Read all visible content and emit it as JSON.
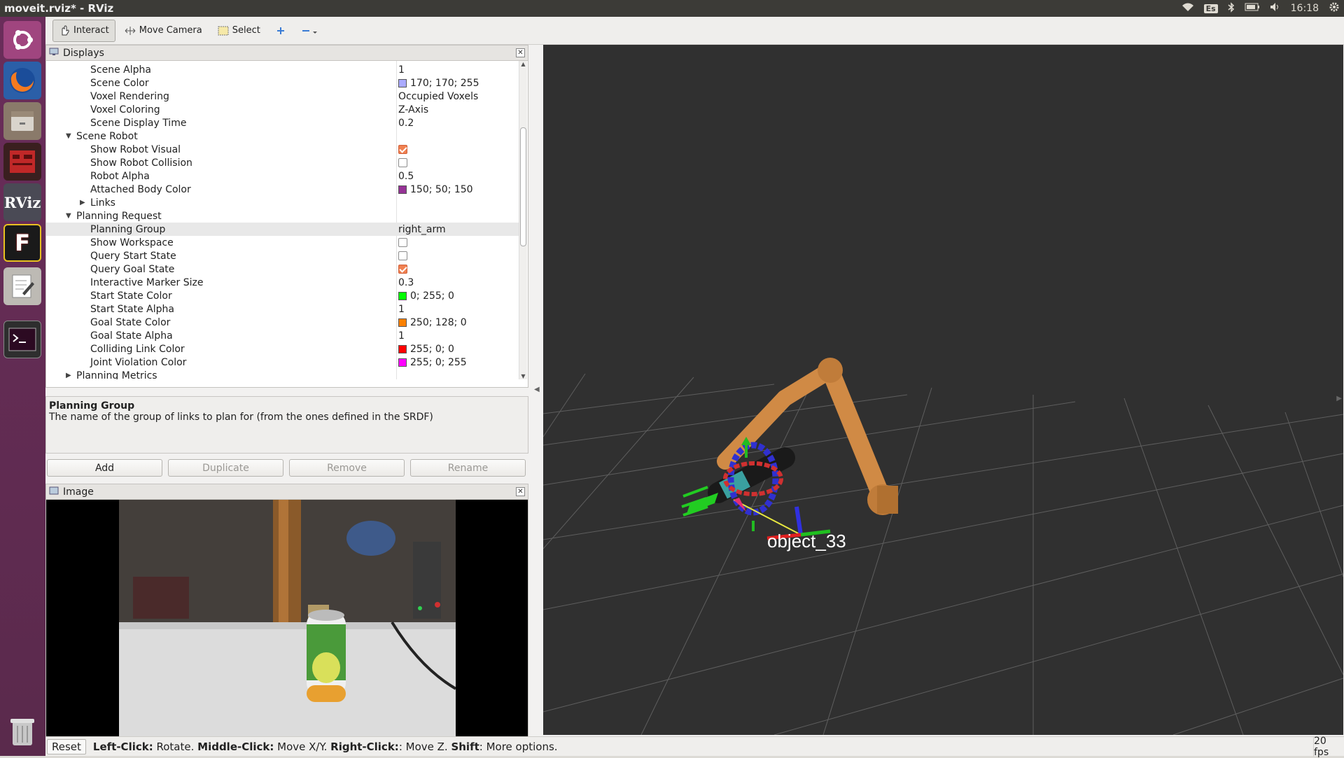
{
  "window": {
    "title": "moveit.rviz* - RViz"
  },
  "tray": {
    "keyboard": "Es",
    "clock": "16:18"
  },
  "launcher": {
    "items": [
      {
        "icon": "ubuntu-dash-icon"
      },
      {
        "icon": "firefox-icon"
      },
      {
        "icon": "files-icon"
      },
      {
        "icon": "red-app-icon"
      },
      {
        "icon": "rviz-icon",
        "label": "RViz"
      },
      {
        "icon": "f-app-icon",
        "label": "F"
      },
      {
        "icon": "text-editor-icon"
      },
      {
        "icon": "terminal-icon"
      },
      {
        "icon": "trash-icon"
      }
    ]
  },
  "toolbar": {
    "interact": "Interact",
    "move_camera": "Move Camera",
    "select": "Select"
  },
  "displays": {
    "title": "Displays",
    "rows": [
      {
        "name": "Scene Alpha",
        "value": "1"
      },
      {
        "name": "Scene Color",
        "value": "170; 170; 255",
        "swatch": "#aaaaff"
      },
      {
        "name": "Voxel Rendering",
        "value": "Occupied Voxels"
      },
      {
        "name": "Voxel Coloring",
        "value": "Z-Axis"
      },
      {
        "name": "Scene Display Time",
        "value": "0.2"
      },
      {
        "name": "Scene Robot",
        "value": ""
      },
      {
        "name": "Show Robot Visual",
        "checked": true
      },
      {
        "name": "Show Robot Collision",
        "checked": false
      },
      {
        "name": "Robot Alpha",
        "value": "0.5"
      },
      {
        "name": "Attached Body Color",
        "value": "150; 50; 150",
        "swatch": "#963296"
      },
      {
        "name": "Links",
        "value": ""
      },
      {
        "name": "Planning Request",
        "value": ""
      },
      {
        "name": "Planning Group",
        "value": "right_arm"
      },
      {
        "name": "Show Workspace",
        "checked": false
      },
      {
        "name": "Query Start State",
        "checked": false
      },
      {
        "name": "Query Goal State",
        "checked": true
      },
      {
        "name": "Interactive Marker Size",
        "value": "0.3"
      },
      {
        "name": "Start State Color",
        "value": "0; 255; 0",
        "swatch": "#00ff00"
      },
      {
        "name": "Start State Alpha",
        "value": "1"
      },
      {
        "name": "Goal State Color",
        "value": "250; 128; 0",
        "swatch": "#fa8000"
      },
      {
        "name": "Goal State Alpha",
        "value": "1"
      },
      {
        "name": "Colliding Link Color",
        "value": "255; 0; 0",
        "swatch": "#ff0000"
      },
      {
        "name": "Joint Violation Color",
        "value": "255; 0; 255",
        "swatch": "#ff00ff"
      },
      {
        "name": "Planning Metrics",
        "value": ""
      }
    ]
  },
  "description": {
    "title": "Planning Group",
    "text": "The name of the group of links to plan for (from the ones defined in the SRDF)"
  },
  "buttons": {
    "add": "Add",
    "duplicate": "Duplicate",
    "remove": "Remove",
    "rename": "Rename"
  },
  "image_panel": {
    "title": "Image"
  },
  "view3d": {
    "marker_label": "object_33"
  },
  "statusbar": {
    "reset": "Reset",
    "left_click_key": "Left-Click:",
    "left_click": " Rotate. ",
    "middle_click_key": "Middle-Click:",
    "middle_click": " Move X/Y. ",
    "right_click_key": "Right-Click:",
    "right_click": ": Move Z. ",
    "shift_key": "Shift",
    "shift": ": More options.",
    "fps": "20 fps"
  },
  "colors": {
    "launcher": "#5a2a4c",
    "topbar": "#3c3b37",
    "view_bg": "#303030",
    "robot_arm": "#d08a45",
    "gripper": "#22cc22"
  }
}
